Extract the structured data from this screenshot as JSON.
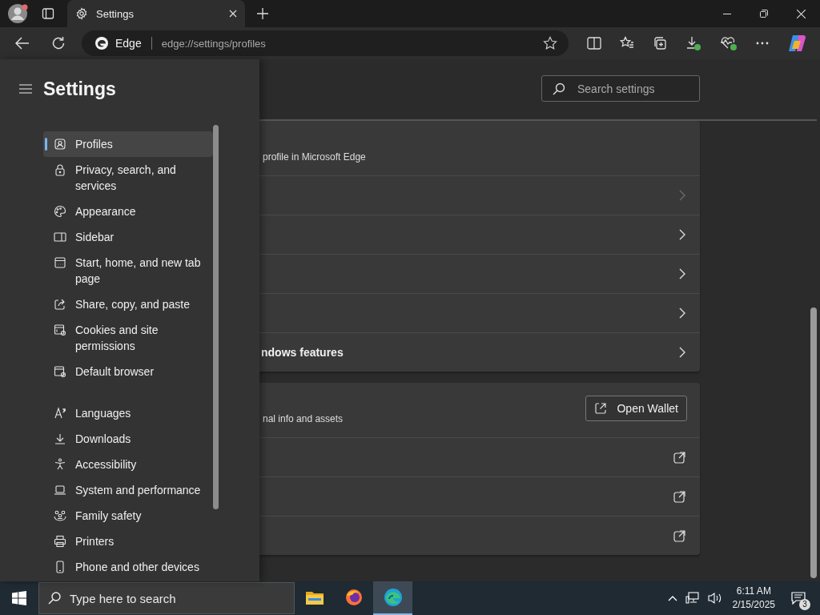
{
  "tabs": [
    {
      "title": "Settings",
      "selected": true
    }
  ],
  "address_bar": {
    "site_label": "Edge",
    "url": "edge://settings/profiles"
  },
  "settings_nav": {
    "title": "Settings",
    "sections": [
      {
        "items": [
          {
            "label": "Profiles",
            "selected": true
          },
          {
            "label": "Privacy, search, and services",
            "selected": false
          },
          {
            "label": "Appearance",
            "selected": false
          },
          {
            "label": "Sidebar",
            "selected": false
          },
          {
            "label": "Start, home, and new tab page",
            "selected": false
          },
          {
            "label": "Share, copy, and paste",
            "selected": false
          },
          {
            "label": "Cookies and site permissions",
            "selected": false
          },
          {
            "label": "Default browser",
            "selected": false
          }
        ]
      },
      {
        "items": [
          {
            "label": "Languages",
            "selected": false
          },
          {
            "label": "Downloads",
            "selected": false
          },
          {
            "label": "Accessibility",
            "selected": false
          },
          {
            "label": "System and performance",
            "selected": false
          },
          {
            "label": "Family safety",
            "selected": false
          },
          {
            "label": "Printers",
            "selected": false
          },
          {
            "label": "Phone and other devices",
            "selected": false
          }
        ]
      }
    ]
  },
  "search": {
    "placeholder": "Search settings"
  },
  "cards": [
    {
      "header_text": "profile in Microsoft Edge",
      "rows": [
        {
          "kind": "chevron",
          "disabled": true
        },
        {
          "kind": "chevron",
          "disabled": false
        },
        {
          "kind": "chevron",
          "disabled": false
        },
        {
          "kind": "chevron",
          "disabled": false
        },
        {
          "kind": "chevron",
          "disabled": false,
          "label": "ndows features"
        }
      ]
    },
    {
      "header_text": "nal info and assets",
      "button": "Open Wallet",
      "rows": [
        {
          "kind": "external"
        },
        {
          "kind": "external"
        },
        {
          "kind": "external"
        }
      ]
    }
  ],
  "taskbar": {
    "search_placeholder": "Type here to search",
    "apps": [
      {
        "selected": false
      },
      {
        "selected": false
      },
      {
        "selected": true
      }
    ],
    "time": "6:11 AM",
    "date": "2/15/2025",
    "notification_count": "3"
  }
}
